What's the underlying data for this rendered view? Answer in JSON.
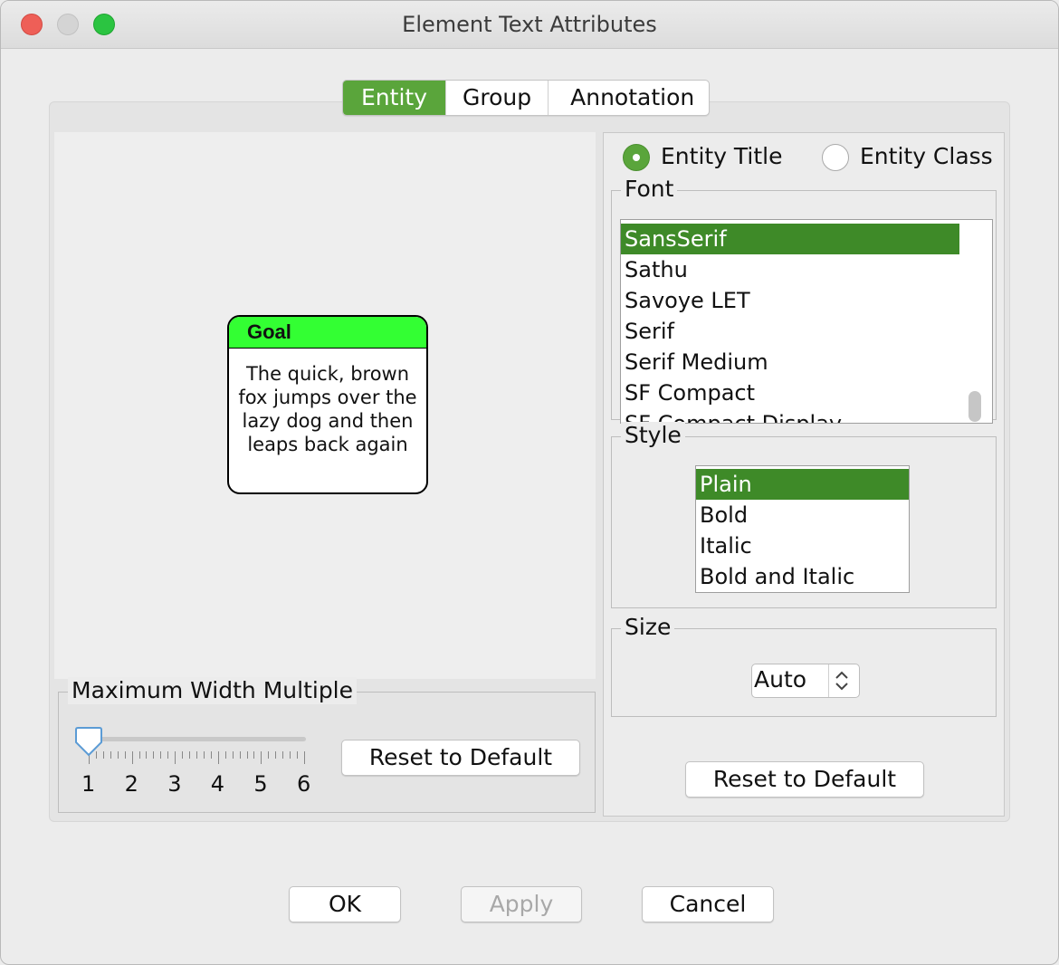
{
  "window": {
    "title": "Element Text Attributes"
  },
  "tabs": [
    {
      "label": "Entity",
      "selected": true
    },
    {
      "label": "Group",
      "selected": false
    },
    {
      "label": "Annotation",
      "selected": false
    }
  ],
  "preview": {
    "title": "Goal",
    "text": "The quick, brown fox jumps over the lazy dog and then leaps back again",
    "header_color": "#33ff33"
  },
  "width_multiple": {
    "label": "Maximum Width Multiple",
    "value": 1,
    "tick_labels": [
      "1",
      "2",
      "3",
      "4",
      "5",
      "6"
    ],
    "reset_label": "Reset to Default"
  },
  "target": {
    "options": [
      {
        "label": "Entity Title",
        "selected": true
      },
      {
        "label": "Entity Class",
        "selected": false
      }
    ]
  },
  "font": {
    "label": "Font",
    "items": [
      "SansSerif",
      "Sathu",
      "Savoye LET",
      "Serif",
      "Serif Medium",
      "SF Compact",
      "SF Compact Display"
    ],
    "selected": "SansSerif"
  },
  "style": {
    "label": "Style",
    "items": [
      "Plain",
      "Bold",
      "Italic",
      "Bold and Italic"
    ],
    "selected": "Plain"
  },
  "size": {
    "label": "Size",
    "value": "Auto"
  },
  "right_reset_label": "Reset to Default",
  "footer": {
    "ok": "OK",
    "apply": "Apply",
    "cancel": "Cancel"
  },
  "accent_color": "#5aa53b"
}
